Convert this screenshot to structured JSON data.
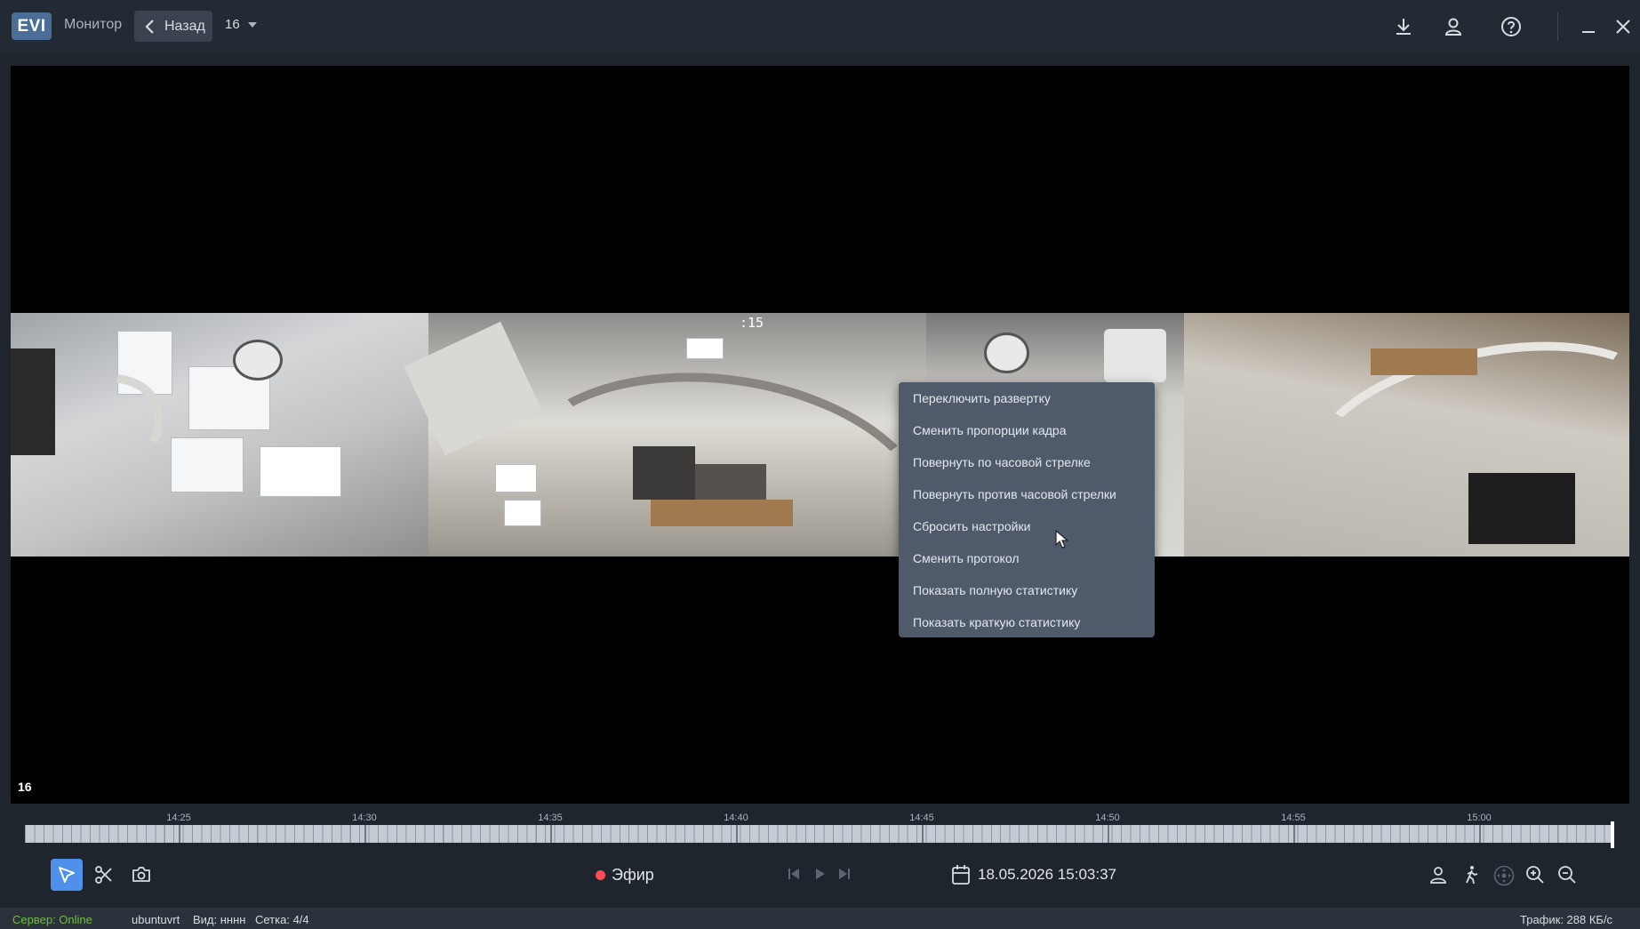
{
  "header": {
    "logo": "EVI",
    "nav_monitor": "Монитор",
    "back_label": "Назад",
    "camera_selected": "16",
    "icons": [
      "download-icon",
      "user-icon",
      "help-icon",
      "minimize-icon",
      "close-icon"
    ]
  },
  "video": {
    "camera_number": "16",
    "osd_time": ":15"
  },
  "context_menu": {
    "items": [
      "Переключить развертку",
      "Сменить пропорции кадра",
      "Повернуть по часовой стрелке",
      "Повернуть против часовой стрелки",
      "Сбросить настройки",
      "Сменить протокол",
      "Показать полную статистику",
      "Показать краткую статистику"
    ]
  },
  "timeline": {
    "labels": [
      "14:25",
      "14:30",
      "14:35",
      "14:40",
      "14:45",
      "14:50",
      "14:55",
      "15:00"
    ]
  },
  "toolbar": {
    "live_label": "Эфир",
    "datetime": "18.05.2026 15:03:37",
    "live_color": "#ff4b55",
    "accent": "#4f90ea"
  },
  "status": {
    "server": "Сервер: Online",
    "host": "ubuntuvrt",
    "view": "Вид: нннн",
    "grid": "Сетка: 4/4",
    "traffic": "Трафик: 288 КБ/с",
    "server_color": "#6fbf3a"
  }
}
